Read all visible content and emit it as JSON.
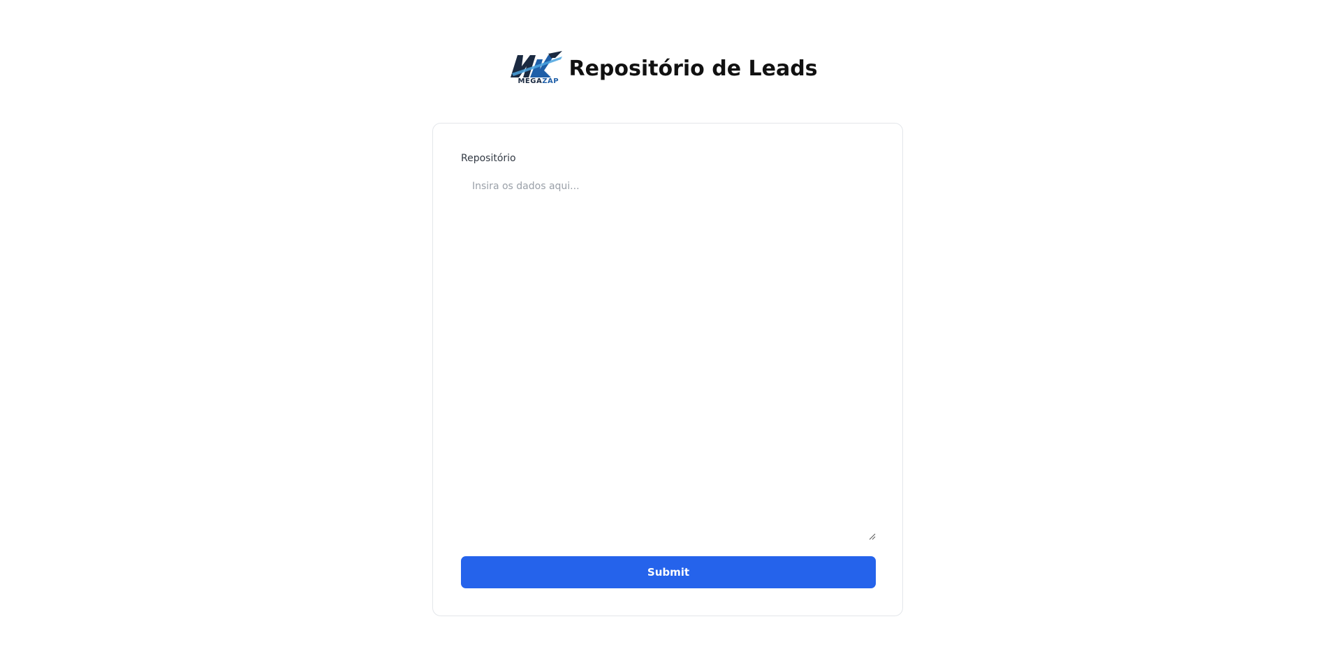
{
  "header": {
    "title": "Repositório de Leads",
    "logo_text_primary": "MEGA",
    "logo_text_accent": "ZAP",
    "logo_icon": "megazap-logo"
  },
  "form": {
    "label": "Repositório",
    "textarea_placeholder": "Insira os dados aqui...",
    "textarea_value": "",
    "submit_label": "Submit"
  },
  "colors": {
    "primary_button": "#2563eb",
    "logo_dark": "#1b2a41",
    "logo_blue": "#1f5fa8",
    "logo_light": "#4aa3df"
  }
}
